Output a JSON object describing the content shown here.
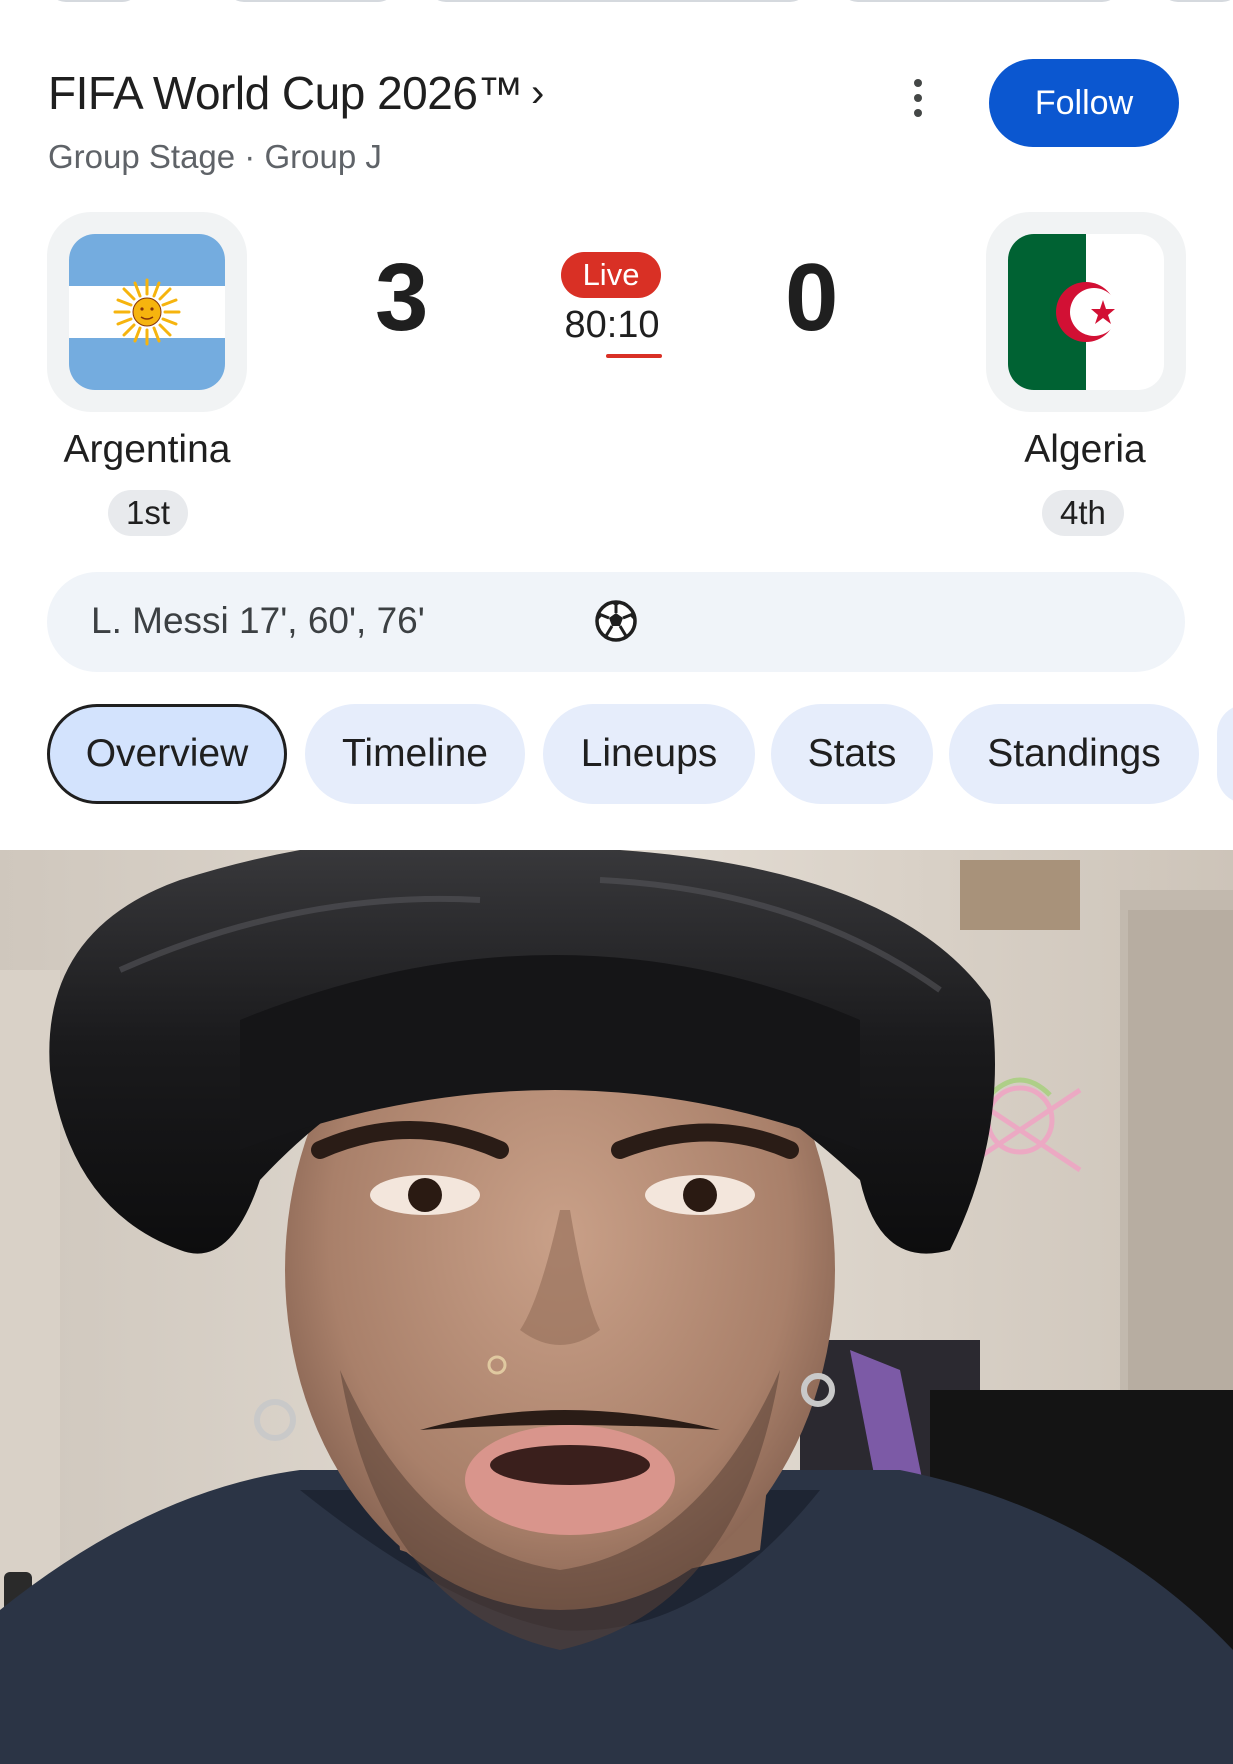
{
  "match": {
    "competition": "FIFA World Cup 2026™",
    "chevron": "›",
    "stage": "Group Stage · Group J",
    "follow_label": "Follow",
    "home": {
      "name": "Argentina",
      "score": "3",
      "rank": "1st"
    },
    "away": {
      "name": "Algeria",
      "score": "0",
      "rank": "4th"
    },
    "status": "Live",
    "clock": "80:10",
    "scorers": "L. Messi 17', 60', 76'"
  },
  "tabs": [
    "Overview",
    "Timeline",
    "Lineups",
    "Stats",
    "Standings"
  ],
  "active_tab": "Overview",
  "colors": {
    "accent": "#0b57d0",
    "live": "#d93025",
    "argentina_blue": "#74acdf",
    "algeria_green": "#006233",
    "algeria_red": "#d21034"
  },
  "icons": {
    "more": "more-vert-icon",
    "ball": "soccer-ball-icon",
    "home_flag": "argentina-flag-icon",
    "away_flag": "algeria-flag-icon"
  }
}
